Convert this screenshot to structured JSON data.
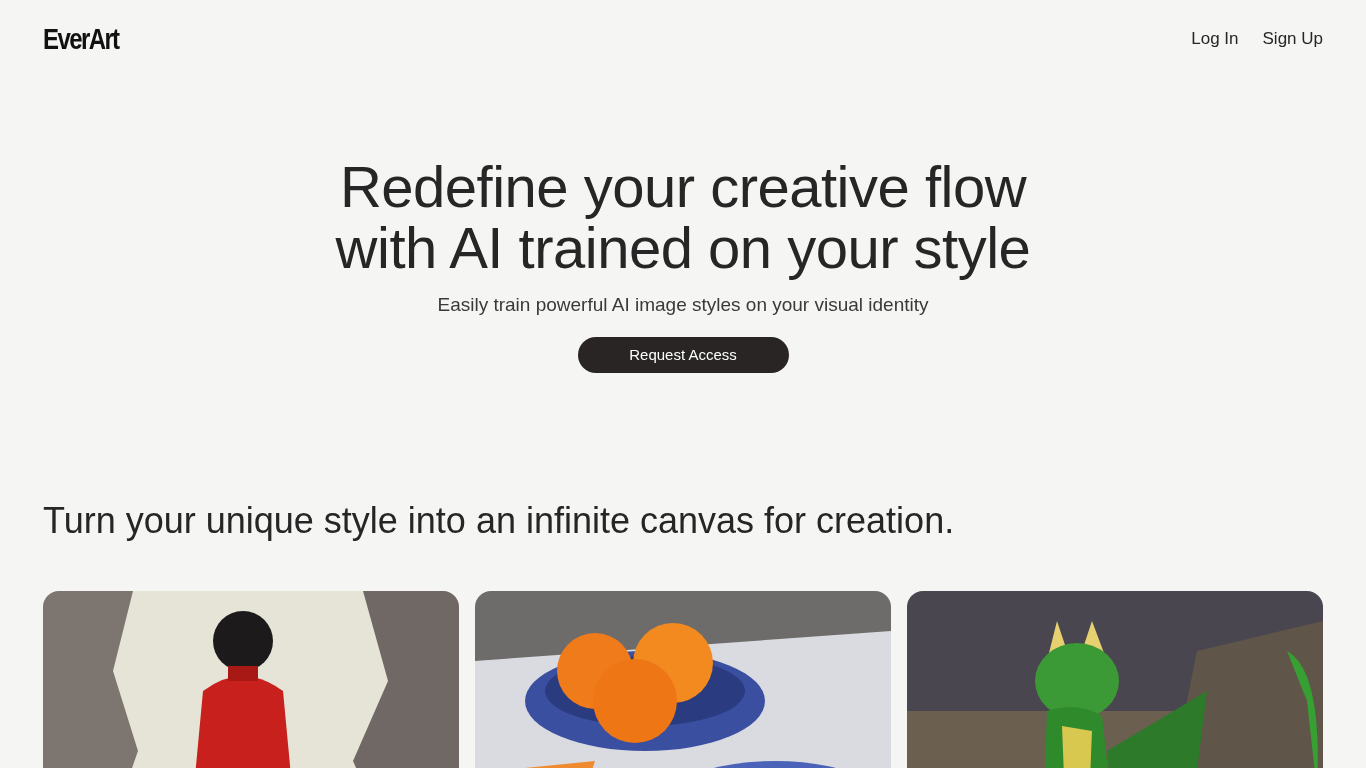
{
  "brand": "EverArt",
  "nav_links": [
    {
      "label": "Log In"
    },
    {
      "label": "Sign Up"
    }
  ],
  "hero": {
    "title_lines": [
      "Redefine your creative flow",
      "with AI trained on your style"
    ],
    "subtitle": "Easily train powerful AI image styles on your visual identity",
    "button": "Request Access"
  },
  "section": {
    "heading": "Turn your unique style into an infinite canvas for creation."
  }
}
